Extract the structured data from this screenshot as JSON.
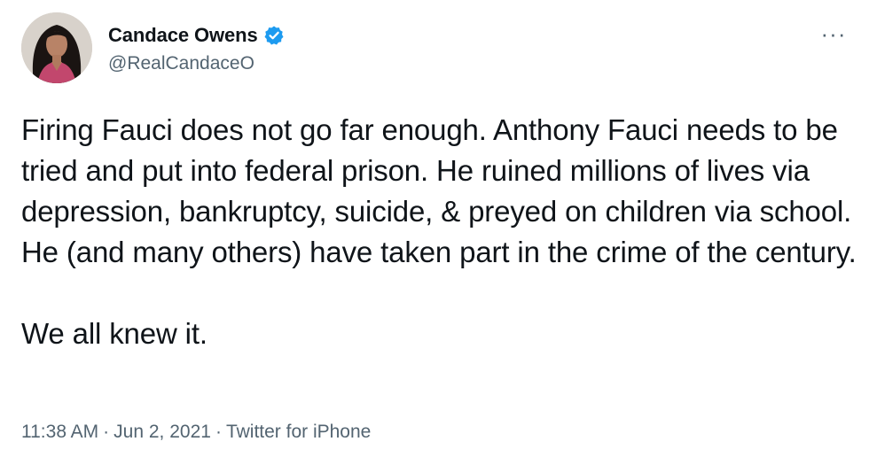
{
  "author": {
    "display_name": "Candace Owens",
    "handle": "@RealCandaceO",
    "verified": true,
    "verified_badge_color": "#1d9bf0",
    "avatar": "profile-photo"
  },
  "more_button": {
    "icon": "more-icon",
    "glyph": "···"
  },
  "tweet": {
    "paragraphs": [
      "Firing Fauci does not go far enough. Anthony Fauci needs to be tried and put into federal prison. He ruined millions of lives via depression, bankruptcy, suicide, & preyed on children via school. He (and many others) have taken part in the crime of the century.",
      "We all knew it."
    ]
  },
  "meta": {
    "time": "11:38 AM",
    "separator": "·",
    "date": "Jun 2, 2021",
    "source": "Twitter for iPhone"
  },
  "colors": {
    "text_primary": "#0f1419",
    "text_secondary": "#536471",
    "background": "#ffffff"
  }
}
